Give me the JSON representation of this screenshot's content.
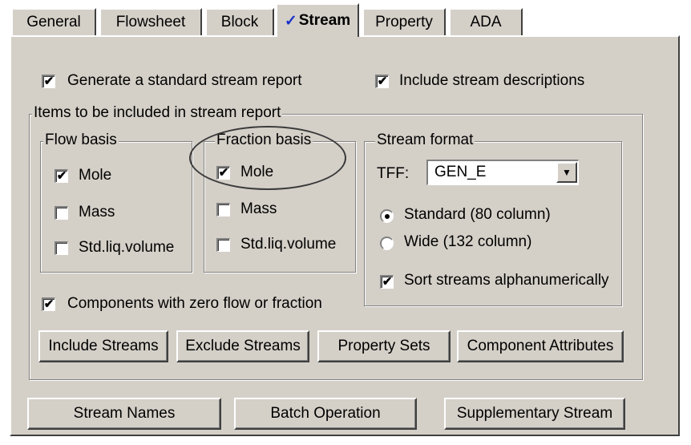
{
  "tabs": [
    {
      "label": "General",
      "active": false
    },
    {
      "label": "Flowsheet",
      "active": false
    },
    {
      "label": "Block",
      "active": false
    },
    {
      "label": "Stream",
      "active": true,
      "check": "✓"
    },
    {
      "label": "Property",
      "active": false
    },
    {
      "label": "ADA",
      "active": false
    }
  ],
  "options": {
    "generate_report": {
      "label": "Generate a standard stream report",
      "checked": true
    },
    "include_descriptions": {
      "label": "Include stream descriptions",
      "checked": true
    }
  },
  "items_group": {
    "title": "Items to be included in stream report",
    "flow_basis": {
      "title": "Flow basis",
      "items": [
        {
          "label": "Mole",
          "checked": true
        },
        {
          "label": "Mass",
          "checked": false
        },
        {
          "label": "Std.liq.volume",
          "checked": false
        }
      ]
    },
    "fraction_basis": {
      "title": "Fraction basis",
      "items": [
        {
          "label": "Mole",
          "checked": true
        },
        {
          "label": "Mass",
          "checked": false
        },
        {
          "label": "Std.liq.volume",
          "checked": false
        }
      ]
    },
    "stream_format": {
      "title": "Stream format",
      "tff_label": "TFF:",
      "tff_value": "GEN_E",
      "standard": {
        "label": "Standard (80 column)",
        "selected": true
      },
      "wide": {
        "label": "Wide (132 column)",
        "selected": false
      },
      "sort": {
        "label": "Sort streams alphanumerically",
        "checked": true
      }
    },
    "zero_flow": {
      "label": "Components with zero flow or fraction",
      "checked": true
    },
    "buttons": {
      "include": "Include Streams",
      "exclude": "Exclude Streams",
      "property_sets": "Property Sets",
      "component_attributes": "Component Attributes"
    }
  },
  "bottom_buttons": {
    "stream_names": "Stream Names",
    "batch_operation": "Batch Operation",
    "supplementary_stream": "Supplementary Stream"
  },
  "colors": {
    "dialog_bg": "#d4d0c8",
    "check_accent": "#1a33c8"
  },
  "icons": {
    "check": "✔",
    "combo_arrow": "▼"
  }
}
